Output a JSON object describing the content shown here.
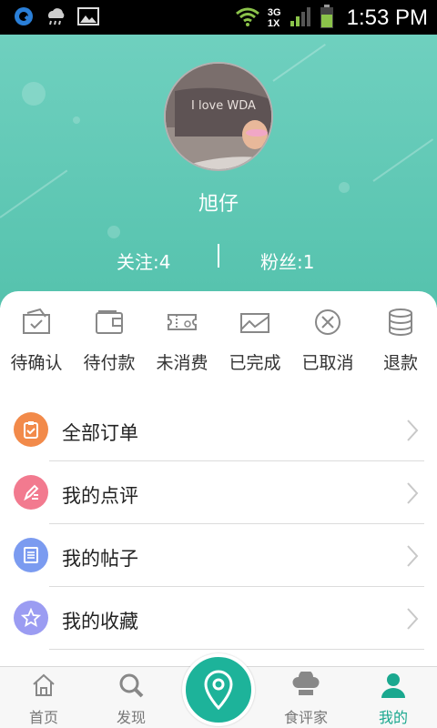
{
  "status_bar": {
    "time": "1:53 PM",
    "network_top": "3G",
    "network_bottom": "1X",
    "left_icons": [
      "app-icon",
      "weather-icon",
      "gallery-icon"
    ],
    "right_icons": [
      "wifi-icon",
      "signal-icon",
      "battery-icon"
    ]
  },
  "profile": {
    "username": "旭仔",
    "following_label": "关注:4",
    "followers_label": "粉丝:1",
    "avatar_caption": "I love WDA"
  },
  "orders": [
    {
      "label": "待确认",
      "icon": "confirm-icon"
    },
    {
      "label": "待付款",
      "icon": "wallet-icon"
    },
    {
      "label": "未消费",
      "icon": "ticket-icon"
    },
    {
      "label": "已完成",
      "icon": "envelope-icon"
    },
    {
      "label": "已取消",
      "icon": "cancel-icon"
    },
    {
      "label": "退款",
      "icon": "coins-icon"
    }
  ],
  "menu": [
    {
      "label": "全部订单",
      "icon": "clipboard-icon",
      "color": "#f28a4a"
    },
    {
      "label": "我的点评",
      "icon": "pen-icon",
      "color": "#f27a8f"
    },
    {
      "label": "我的帖子",
      "icon": "document-icon",
      "color": "#7b9bf0"
    },
    {
      "label": "我的收藏",
      "icon": "star-icon",
      "color": "#9b9cf2"
    }
  ],
  "bottom_nav": {
    "items": [
      {
        "label": "首页",
        "icon": "home-icon"
      },
      {
        "label": "发现",
        "icon": "search-icon"
      },
      {
        "label": "食评家",
        "icon": "chef-hat-icon"
      },
      {
        "label": "我的",
        "icon": "user-icon"
      }
    ],
    "center_icon": "location-pin-icon"
  },
  "colors": {
    "accent": "#1db39a",
    "header": "#5fc6b2",
    "active_tab": "#1aa88f",
    "inactive_tab": "#777777"
  }
}
